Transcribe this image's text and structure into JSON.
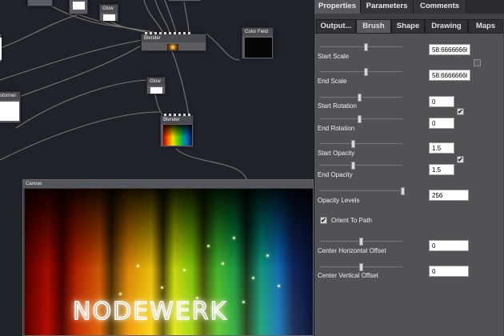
{
  "nodes": {
    "blender_top": {
      "title": "Blender"
    },
    "color_field": {
      "title": "Color Field"
    },
    "glow_top": {
      "title": "Glow"
    },
    "glow_mid": {
      "title": "Glow"
    },
    "transformer": {
      "title": "sformer"
    },
    "blender_mid": {
      "title": "Blender"
    },
    "canvas": {
      "title": "Canvas",
      "artwork_text": "NODEWERK"
    }
  },
  "panel": {
    "tabs": [
      {
        "label": "Properties",
        "active": true
      },
      {
        "label": "Parameters",
        "active": false
      },
      {
        "label": "Comments",
        "active": false
      }
    ],
    "subtabs": [
      {
        "label": "Output...",
        "active": false
      },
      {
        "label": "Brush",
        "active": true
      },
      {
        "label": "Shape",
        "active": false
      },
      {
        "label": "Drawing",
        "active": false
      },
      {
        "label": "Maps",
        "active": false
      }
    ],
    "params": {
      "start_scale": {
        "label": "Start Scale",
        "value": "58.66666666667",
        "slider": 0.56
      },
      "end_scale": {
        "label": "End Scale",
        "value": "58.66666666667",
        "slider": 0.56
      },
      "start_rotation": {
        "label": "Start Rotation",
        "value": "0",
        "slider": 0.48
      },
      "end_rotation": {
        "label": "End Rotation",
        "value": "0",
        "slider": 0.48
      },
      "start_opacity": {
        "label": "Start Opacity",
        "value": "1.5",
        "slider": 0.4
      },
      "end_opacity": {
        "label": "End Opacity",
        "value": "1.5",
        "slider": 0.4
      },
      "opacity_levels": {
        "label": "Opacity Levels",
        "value": "256",
        "slider": 1.0
      },
      "orient_to_path": {
        "label": "Orient To Path",
        "checked": true
      },
      "center_h_offset": {
        "label": "Center Horizontal Offset",
        "value": "0",
        "slider": 0.5
      },
      "center_v_offset": {
        "label": "Center Vertical Offset",
        "value": "0",
        "slider": 0.5
      }
    },
    "links": {
      "scale_link": false,
      "rotation_link": true,
      "opacity_link": true
    }
  },
  "colors": {
    "panel_bg": "#505256",
    "editor_bg": "#20222a",
    "wire": "#8a8678",
    "active_tab": "#55575c"
  }
}
